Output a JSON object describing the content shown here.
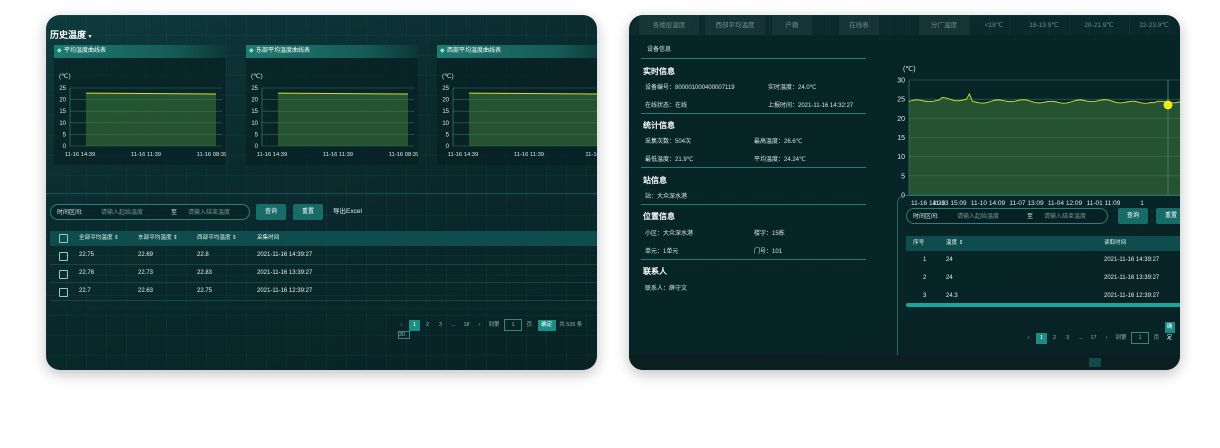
{
  "left": {
    "title": "历史温度",
    "charts": [
      {
        "label": "平均温度曲线表",
        "unit": "(℃)",
        "yticks": [
          "25",
          "20",
          "15",
          "10",
          "5",
          "0"
        ],
        "xticks": [
          "11-16 14:39",
          "11-16 11:39",
          "11-16 08:39"
        ]
      },
      {
        "label": "东部平均温度曲线表",
        "unit": "(℃)",
        "yticks": [
          "25",
          "20",
          "15",
          "10",
          "5",
          "0"
        ],
        "xticks": [
          "11-16 14:39",
          "11-16 11:39",
          "11-16 08:39"
        ]
      },
      {
        "label": "西部平均温度曲线表",
        "unit": "(℃)",
        "yticks": [
          "25",
          "20",
          "15",
          "10",
          "5",
          "0"
        ],
        "xticks": [
          "11-16 14:39",
          "11-16 11:39",
          "11-16 0"
        ]
      }
    ],
    "filter": {
      "label": "时间区间:",
      "start_placeholder": "请输入起始温度",
      "to": "至",
      "end_placeholder": "请输入结束温度",
      "query": "查询",
      "reset": "重置",
      "export": "导出Excel"
    },
    "table": {
      "headers": [
        "全部平均温度",
        "东部平均温度",
        "西部平均温度",
        "采集时间"
      ],
      "rows": [
        [
          "22.75",
          "22.69",
          "22.8",
          "2021-11-16 14:39:27"
        ],
        [
          "22.78",
          "22.73",
          "22.83",
          "2021-11-16 13:39:27"
        ],
        [
          "22.7",
          "22.63",
          "22.75",
          "2021-11-16 12:39:27"
        ]
      ]
    },
    "pager": {
      "pages": [
        "1",
        "2",
        "3",
        "...",
        "18"
      ],
      "goto": "到第",
      "page_value": "1",
      "page_suffix": "页",
      "confirm": "确定",
      "total": "共 535 条",
      "size": "30"
    }
  },
  "right": {
    "topnav": [
      "各楼层温度",
      "西部平均温度",
      "户籍",
      "在线表",
      "分厂温度",
      "<18℃",
      "18-19.9℃",
      "20-21.9℃",
      "22-23.9℃"
    ],
    "device_header": "设备信息",
    "realtime": {
      "title": "实时信息",
      "device_no": "设备编号：800001000400007119",
      "temp": "实时温度：24.0℃",
      "status": "在线状态：在线",
      "report_time": "上报时间：2021-11-16 14:32:27"
    },
    "stats": {
      "title": "统计信息",
      "count": "采集次数：504次",
      "max": "最高温度：26.6℃",
      "min": "最低温度：21.9℃",
      "avg": "平均温度：24.24℃"
    },
    "station": {
      "title": "站信息",
      "name": "站：大众深水港"
    },
    "location": {
      "title": "位置信息",
      "district": "小区：大众深水港",
      "building": "楼字：15栋",
      "unit": "单元：1单元",
      "door": "门号：101"
    },
    "contact": {
      "title": "联系人",
      "name": "联系人：薛守文"
    },
    "chart": {
      "unit": "(℃)",
      "yticks": [
        "30",
        "25",
        "20",
        "15",
        "10",
        "5",
        "0"
      ],
      "xticks": [
        "11-16 14:39",
        "11-13 15:09",
        "11-10 14:09",
        "11-07 13:09",
        "11-04 12:09",
        "11-01 11:09",
        "1"
      ]
    },
    "filter": {
      "label": "时间区间:",
      "start_placeholder": "请输入起始温度",
      "to": "至",
      "end_placeholder": "请输入结束温度",
      "query": "查询",
      "reset": "重置"
    },
    "table": {
      "headers": [
        "序号",
        "温度",
        "读取时间"
      ],
      "rows": [
        [
          "1",
          "24",
          "2021-11-16 14:39:27"
        ],
        [
          "2",
          "24",
          "2021-11-16 13:39:27"
        ],
        [
          "3",
          "24.3",
          "2021-11-16 12:39:27"
        ]
      ]
    },
    "pager": {
      "pages": [
        "1",
        "2",
        "3",
        "...",
        "17"
      ],
      "goto": "到第",
      "page_value": "1",
      "page_suffix": "页",
      "confirm": "确定"
    }
  },
  "colors": {
    "accent": "#1a8d86",
    "line": "#d6e02a",
    "fill": "#3e7a3a"
  }
}
